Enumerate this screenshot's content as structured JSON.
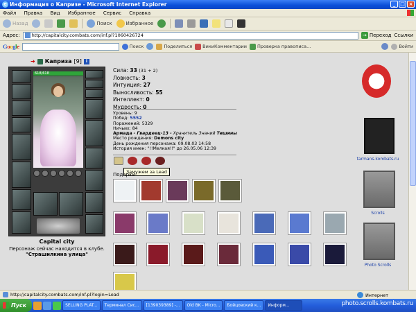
{
  "window": {
    "title": "Информация о Капризе - Microsoft Internet Explorer"
  },
  "menu": [
    "Файл",
    "Правка",
    "Вид",
    "Избранное",
    "Сервис",
    "Справка"
  ],
  "toolbar": {
    "back": "Назад",
    "search": "Поиск",
    "favorites": "Избранное"
  },
  "address": {
    "label": "Адрес:",
    "url": "http://capitalcity.combats.com/inf.pl?1060426724",
    "go": "Переход",
    "links": "Ссылки"
  },
  "google": {
    "logo": [
      "G",
      "o",
      "o",
      "g",
      "l",
      "e"
    ],
    "search": "Поиск",
    "share": "Поделиться",
    "wiki": "ВикиКомментарии",
    "spell": "Проверка правописа...",
    "login": "Войти"
  },
  "character": {
    "name": "Каприза",
    "level": "[9]",
    "hp": "618/618"
  },
  "location": {
    "city": "Capital city",
    "club": "Персонаж сейчас находится в клубе.",
    "street": "\"Страшилкина улица\""
  },
  "stats": [
    {
      "label": "Сила:",
      "value": "33",
      "extra": "(31 + 2)"
    },
    {
      "label": "Ловкость:",
      "value": "3",
      "extra": ""
    },
    {
      "label": "Интуиция:",
      "value": "27",
      "extra": ""
    },
    {
      "label": "Выносливость:",
      "value": "55",
      "extra": ""
    },
    {
      "label": "Интеллект:",
      "value": "0",
      "extra": ""
    },
    {
      "label": "Мудрость:",
      "value": "0",
      "extra": ""
    }
  ],
  "details": {
    "level_label": "Уровень:",
    "level": "9",
    "wins_label": "Побед:",
    "wins": "5552",
    "losses_label": "Поражений:",
    "losses": "5329",
    "draws_label": "Ничьих:",
    "draws": "84",
    "army_label": "Армада",
    "army_rank": "- Гвардеец-13 -",
    "army_title": "Хранитель Знаний",
    "army_clan": "Тишины",
    "birthplace_label": "Место рождения:",
    "birthplace": "Demons city",
    "birthday_label": "День рождения персонажа:",
    "birthday": "09.08.03 14:58",
    "history_label": "История имен:",
    "history": "\"!!Мелкая!!\" до 26.05.06 12:39"
  },
  "tooltip": "Замужем за Lead",
  "gifts_label": "Подарки:",
  "sidebar": {
    "tarmans": "tarmans.kombats.ru",
    "scrolls": "Scrolls",
    "photo_scrolls": "Photo Scrolls"
  },
  "status": {
    "url": "http://capitalcity.combats.com/inf.pl?login=Lead",
    "zone": "Интернет"
  },
  "taskbar": {
    "start": "Пуск",
    "tasks": [
      "SELLING PLAT...",
      "Терминал Сис...",
      "[139039389] -...",
      "Old BK - Micro...",
      "Бойцовский к...",
      "Информ..."
    ]
  },
  "watermark": "photo.scrolls.kombats.ru"
}
